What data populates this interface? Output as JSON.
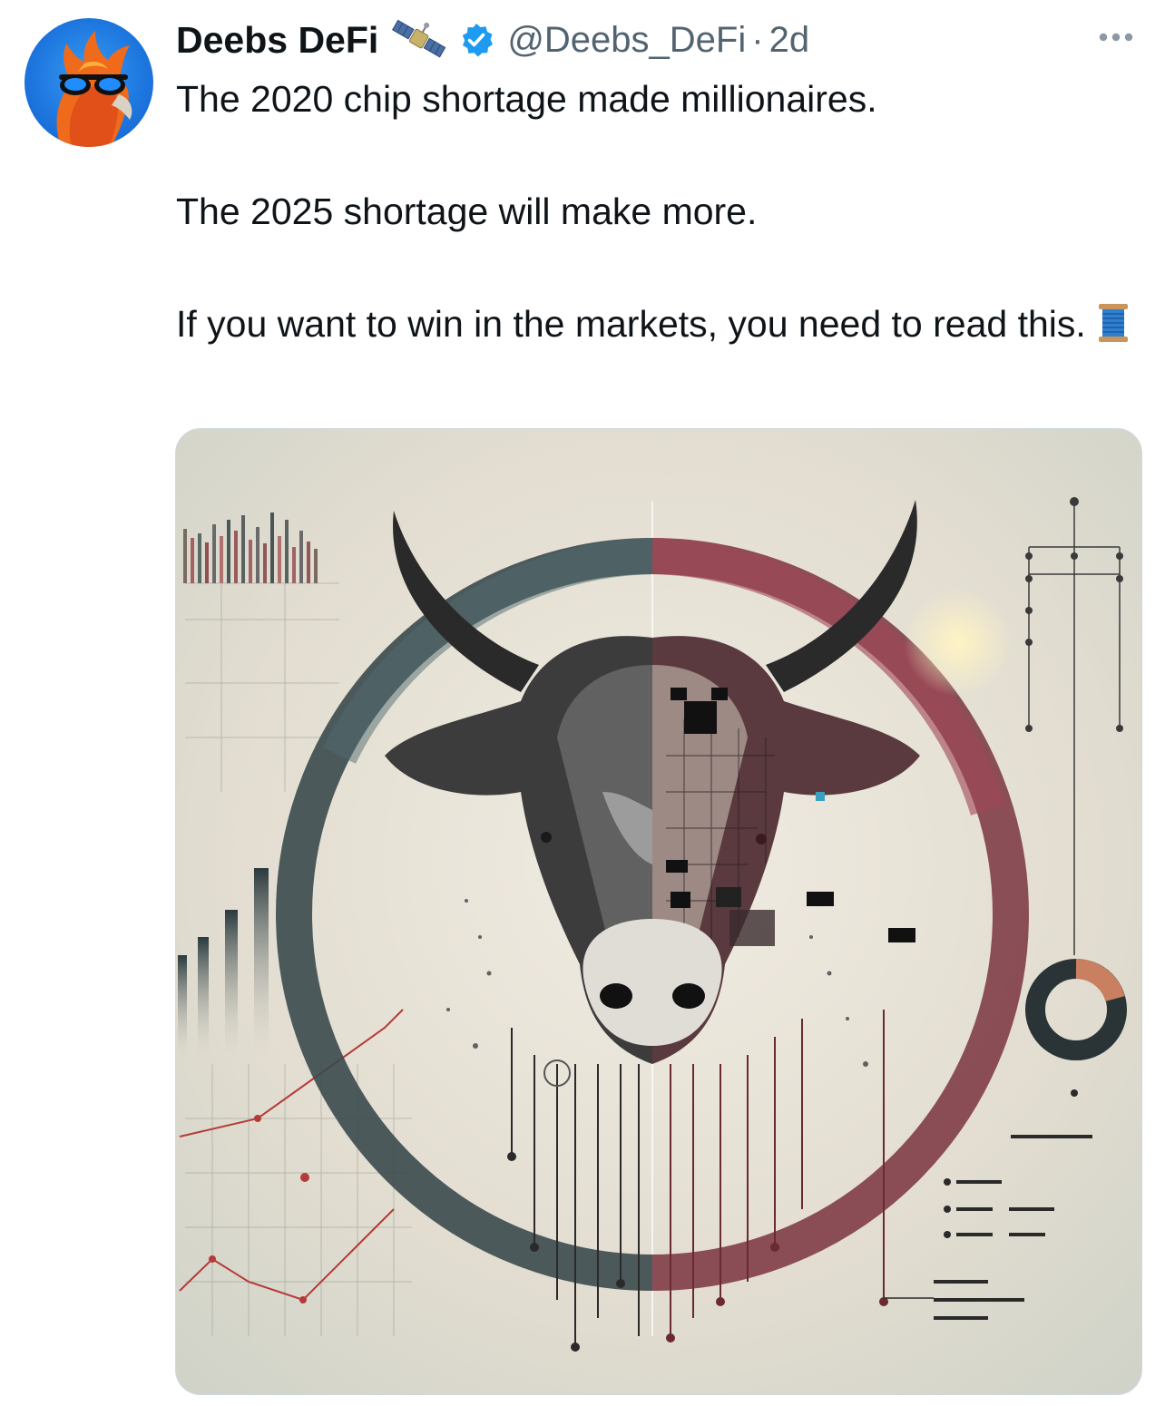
{
  "tweet": {
    "author_name": "Deebs DeFi",
    "name_emoji": "satellite",
    "verified": true,
    "handle": "@Deebs_DeFi",
    "separator": "·",
    "time": "2d",
    "line1": "The 2020 chip shortage made millionaires.",
    "line2": "The 2025 shortage will make more.",
    "line3": "If you want to win in the markets, you need to read this.",
    "trailing_emoji": "thread-spool",
    "accent_color": "#1d9bf0",
    "secondary_text_color": "#536471"
  },
  "icons": {
    "avatar": "avatar-phoenix-sunglasses",
    "verified": "verified-badge-icon",
    "more": "more-options-icon"
  }
}
